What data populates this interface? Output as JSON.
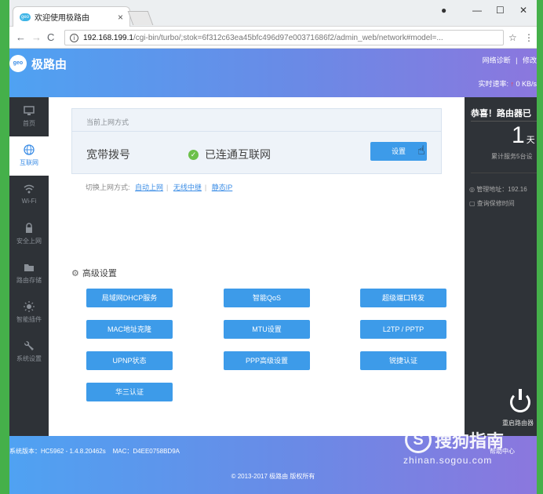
{
  "browser": {
    "tab_title": "欢迎使用极路由",
    "favicon_text": "geo",
    "tab_close": "×",
    "nav_back": "←",
    "nav_forward": "→",
    "nav_reload": "C",
    "url_host": "192.168.199.1",
    "url_path": "/cgi-bin/turbo/;stok=6f312c63ea45bfc496d97e00371686f2/admin_web/network#model=...",
    "window_controls": {
      "account": "●",
      "minimize": "—",
      "maximize": "☐",
      "close": "✕"
    }
  },
  "header": {
    "logo_mark": "geo",
    "logo_text": "极路由",
    "link_diagnose": "网络诊断",
    "link_sep": "|",
    "link_modify": "修改",
    "speed_label": "实时速率:",
    "speed_up_arrow": "↑",
    "speed_value": "0 KB/s"
  },
  "sidebar": {
    "items": [
      {
        "label": "首页",
        "icon": "monitor-icon"
      },
      {
        "label": "互联网",
        "icon": "globe-icon",
        "active": true
      },
      {
        "label": "Wi-Fi",
        "icon": "wifi-icon"
      },
      {
        "label": "安全上网",
        "icon": "lock-icon"
      },
      {
        "label": "路由存储",
        "icon": "folder-icon"
      },
      {
        "label": "智能插件",
        "icon": "sun-icon"
      },
      {
        "label": "系统设置",
        "icon": "wrench-icon"
      }
    ]
  },
  "main": {
    "current_title": "当前上网方式",
    "conn_type": "宽带拨号",
    "conn_status": "已连通互联网",
    "setup_button": "设置",
    "switch_label": "切换上网方式:",
    "switch_links": [
      "自动上网",
      "无线中继",
      "静态IP"
    ],
    "adv_title": "高级设置",
    "adv_buttons": [
      "局域网DHCP服务",
      "智能QoS",
      "超级端口转发",
      "MAC地址克隆",
      "MTU设置",
      "L2TP / PPTP",
      "UPNP状态",
      "PPP高级设置",
      "锐捷认证",
      "华三认证"
    ]
  },
  "right_panel": {
    "congrats": "恭喜！路由器已",
    "days": "1",
    "days_unit": "天",
    "served": "累计服务5台设",
    "mgmt_addr": "管理地址：192.16",
    "warranty": "查询保修时间",
    "restart": "重启路由器"
  },
  "footer": {
    "version": "系统版本：HC5962 - 1.4.8.20462s",
    "mac": "MAC：D4EE0758BD9A",
    "help": "帮助中心",
    "copyright": "© 2013-2017 极路由 版权所有"
  },
  "watermark": {
    "logo_char": "S",
    "text": "搜狗指南",
    "url": "zhinan.sogou.com"
  },
  "colors": {
    "accent": "#3d9be9",
    "sidebar_bg": "#2e3237",
    "success": "#6cc04a",
    "frame_green": "#45b04a"
  }
}
